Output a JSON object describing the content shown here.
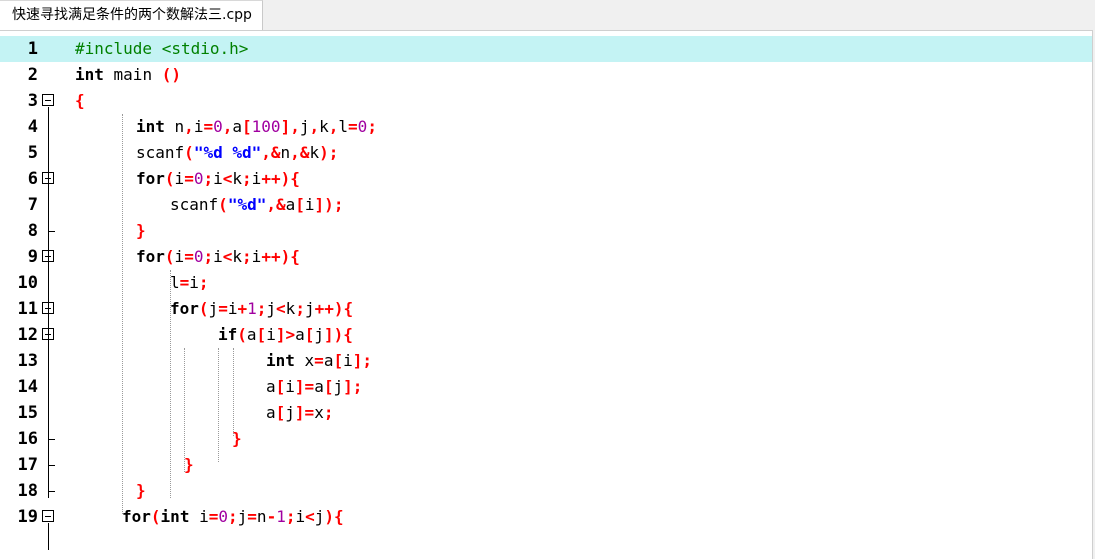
{
  "tab": {
    "label": "快速寻找满足条件的两个数解法三.cpp"
  },
  "editor": {
    "current_line": 1,
    "lines": [
      {
        "num": "1"
      },
      {
        "num": "2"
      },
      {
        "num": "3"
      },
      {
        "num": "4"
      },
      {
        "num": "5"
      },
      {
        "num": "6"
      },
      {
        "num": "7"
      },
      {
        "num": "8"
      },
      {
        "num": "9"
      },
      {
        "num": "10"
      },
      {
        "num": "11"
      },
      {
        "num": "12"
      },
      {
        "num": "13"
      },
      {
        "num": "14"
      },
      {
        "num": "15"
      },
      {
        "num": "16"
      },
      {
        "num": "17"
      },
      {
        "num": "18"
      },
      {
        "num": "19"
      }
    ],
    "tokens": {
      "l1": [
        "#include <stdio.h>"
      ],
      "l2": [
        "int",
        " main ",
        "()"
      ],
      "l3": [
        "{"
      ],
      "l4": [
        "int",
        " n",
        ",",
        "i",
        "=",
        "0",
        ",",
        "a",
        "[",
        "100",
        "],",
        "j",
        ",",
        "k",
        ",",
        "l",
        "=",
        "0",
        ";"
      ],
      "l5": [
        "scanf",
        "(",
        "\"%d %d\"",
        ",",
        "&",
        "n",
        ",",
        "&",
        "k",
        ");"
      ],
      "l6": [
        "for",
        "(",
        "i",
        "=",
        "0",
        ";",
        "i",
        "<",
        "k",
        ";",
        "i",
        "++){"
      ],
      "l7": [
        "scanf",
        "(",
        "\"%d\"",
        ",",
        "&",
        "a",
        "[",
        "i",
        "]);"
      ],
      "l8": [
        "}"
      ],
      "l9": [
        "for",
        "(",
        "i",
        "=",
        "0",
        ";",
        "i",
        "<",
        "k",
        ";",
        "i",
        "++){"
      ],
      "l10": [
        "l",
        "=",
        "i",
        ";"
      ],
      "l11": [
        "for",
        "(",
        "j",
        "=",
        "i",
        "+",
        "1",
        ";",
        "j",
        "<",
        "k",
        ";",
        "j",
        "++){"
      ],
      "l12": [
        "if",
        "(",
        "a",
        "[",
        "i",
        "]>",
        "a",
        "[",
        "j",
        "]){"
      ],
      "l13": [
        "int",
        " x",
        "=",
        "a",
        "[",
        "i",
        "];"
      ],
      "l14": [
        "a",
        "[",
        "i",
        "]=",
        "a",
        "[",
        "j",
        "];"
      ],
      "l15": [
        "a",
        "[",
        "j",
        "]=",
        "x",
        ";"
      ],
      "l16": [
        "}"
      ],
      "l17": [
        "}"
      ],
      "l18": [
        "}"
      ],
      "l19": [
        "for",
        "(",
        "int",
        " i",
        "=",
        "0",
        ";",
        "j",
        "=",
        "n",
        "-",
        "1",
        ";",
        "i",
        "<",
        "j",
        "){"
      ]
    }
  },
  "colors": {
    "current_line_bg": "#c4f3f4",
    "keyword": "#000000",
    "operator": "#ff0000",
    "number": "#a000a0",
    "string": "#0000ff",
    "preprocessor": "#008000"
  }
}
